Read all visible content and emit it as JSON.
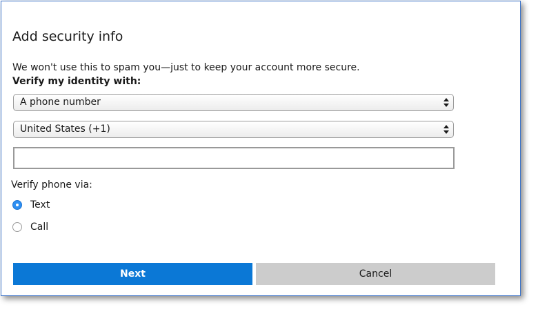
{
  "dialog": {
    "title": "Add security info",
    "description": "We won't use this to spam you—just to keep your account more secure.",
    "verify_label": "Verify my identity with:",
    "method_select": {
      "value": "A phone number"
    },
    "country_select": {
      "value": "United States (+1)"
    },
    "phone_input": {
      "value": "",
      "placeholder": ""
    },
    "verify_via_label": "Verify phone via:",
    "options": [
      {
        "label": "Text",
        "selected": true
      },
      {
        "label": "Call",
        "selected": false
      }
    ],
    "next_button": "Next",
    "cancel_button": "Cancel"
  },
  "colors": {
    "primary_button": "#0b78d6",
    "secondary_button": "#cccccc",
    "radio_selected": "#2d8ff2",
    "border": "#3a72c8"
  }
}
